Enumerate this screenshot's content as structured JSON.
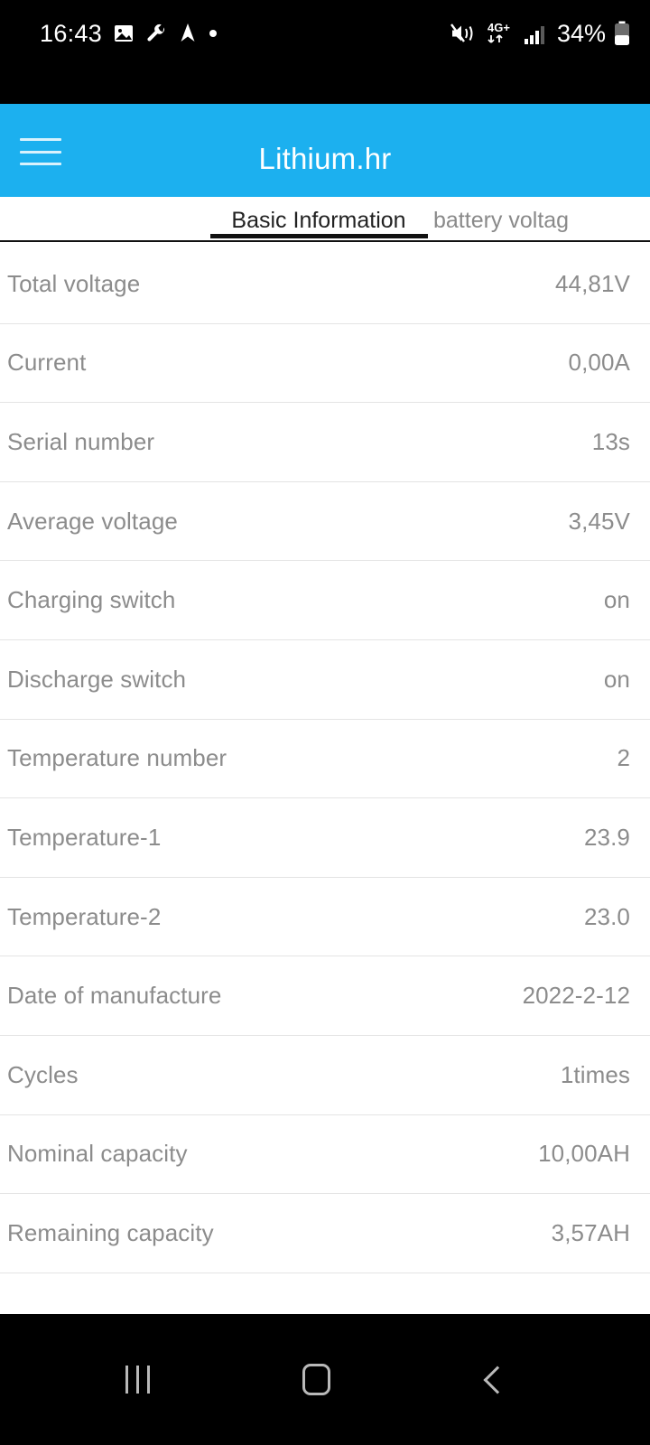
{
  "status_bar": {
    "time": "16:43",
    "battery_percent": "34%",
    "network_type": "4G+",
    "left_icons": [
      "image-icon",
      "wrench-icon",
      "navigation-icon",
      "dot-icon"
    ],
    "right_icons": [
      "mute-vibrate-icon",
      "mobile-data-icon",
      "signal-bars-icon",
      "battery-icon"
    ]
  },
  "appbar": {
    "title": "Lithium.hr",
    "menu_icon": "hamburger-menu-icon",
    "background_color": "#1cb0ef"
  },
  "tabs": [
    {
      "label": "Basic Information",
      "active": true
    },
    {
      "label": "battery voltag",
      "active": false
    }
  ],
  "rows": [
    {
      "label": "Total voltage",
      "value": "44,81V"
    },
    {
      "label": "Current",
      "value": "0,00A"
    },
    {
      "label": "Serial number",
      "value": "13s"
    },
    {
      "label": "Average voltage",
      "value": "3,45V"
    },
    {
      "label": "Charging switch",
      "value": "on"
    },
    {
      "label": "Discharge switch",
      "value": "on"
    },
    {
      "label": "Temperature number",
      "value": "2"
    },
    {
      "label": "Temperature-1",
      "value": "23.9"
    },
    {
      "label": "Temperature-2",
      "value": "23.0"
    },
    {
      "label": "Date of manufacture",
      "value": "2022-2-12"
    },
    {
      "label": "Cycles",
      "value": "1times"
    },
    {
      "label": "Nominal capacity",
      "value": "10,00AH"
    },
    {
      "label": "Remaining capacity",
      "value": "3,57AH"
    }
  ],
  "nav_bar": {
    "recents_icon": "recents-icon",
    "home_icon": "home-icon",
    "back_icon": "back-icon"
  }
}
